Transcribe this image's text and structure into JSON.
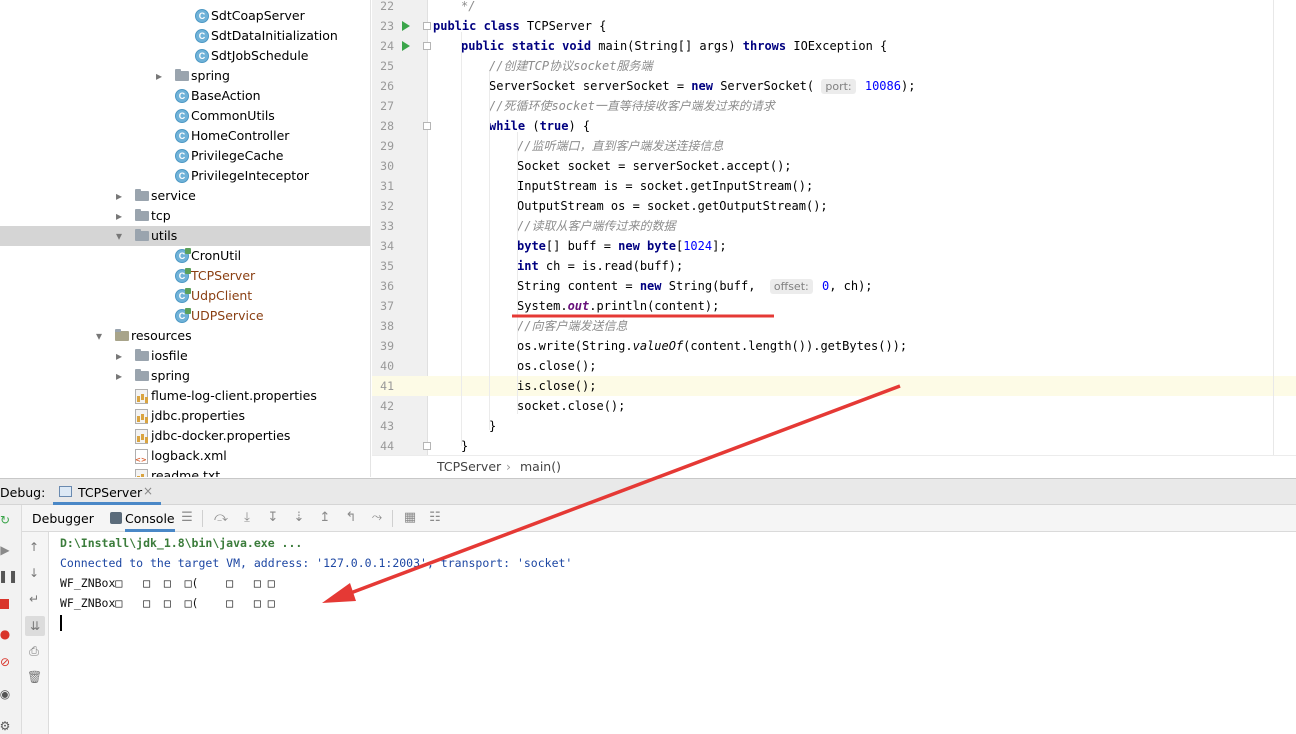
{
  "tree": {
    "items": [
      {
        "label": "SdtCoapServer",
        "icon": "class-icon",
        "depth": 4,
        "mod": false
      },
      {
        "label": "SdtDataInitialization",
        "icon": "class-icon",
        "depth": 4,
        "mod": false
      },
      {
        "label": "SdtJobSchedule",
        "icon": "class-icon",
        "depth": 4,
        "mod": false
      },
      {
        "label": "spring",
        "icon": "folder-icon",
        "depth": 3,
        "arrow": "›"
      },
      {
        "label": "BaseAction",
        "icon": "class-icon",
        "depth": 3,
        "mod": false
      },
      {
        "label": "CommonUtils",
        "icon": "class-icon",
        "depth": 3,
        "mod": false
      },
      {
        "label": "HomeController",
        "icon": "class-icon",
        "depth": 3,
        "mod": false
      },
      {
        "label": "PrivilegeCache",
        "icon": "class-icon",
        "depth": 3,
        "mod": false
      },
      {
        "label": "PrivilegeInteceptor",
        "icon": "class-icon",
        "depth": 3,
        "mod": false
      },
      {
        "label": "service",
        "icon": "folder-icon",
        "depth": 2,
        "arrow": "›"
      },
      {
        "label": "tcp",
        "icon": "folder-icon",
        "depth": 2,
        "arrow": "›"
      },
      {
        "label": "utils",
        "icon": "folder-icon",
        "depth": 2,
        "arrow": "⌄",
        "selected": true
      },
      {
        "label": "CronUtil",
        "icon": "class-icon",
        "depth": 3,
        "mod": true,
        "plain": true
      },
      {
        "label": "TCPServer",
        "icon": "class-icon",
        "depth": 3,
        "mod": true
      },
      {
        "label": "UdpClient",
        "icon": "class-icon",
        "depth": 3,
        "mod": true
      },
      {
        "label": "UDPService",
        "icon": "class-icon",
        "depth": 3,
        "mod": true
      },
      {
        "label": "resources",
        "icon": "resources-folder-icon",
        "depth": 1,
        "arrow": "⌄"
      },
      {
        "label": "iosfile",
        "icon": "folder-icon",
        "depth": 2,
        "arrow": "›"
      },
      {
        "label": "spring",
        "icon": "folder-icon",
        "depth": 2,
        "arrow": "›"
      },
      {
        "label": "flume-log-client.properties",
        "icon": "properties-file-icon",
        "depth": 2
      },
      {
        "label": "jdbc.properties",
        "icon": "properties-file-icon",
        "depth": 2
      },
      {
        "label": "jdbc-docker.properties",
        "icon": "properties-file-icon",
        "depth": 2
      },
      {
        "label": "logback.xml",
        "icon": "xml-file-icon",
        "depth": 2
      },
      {
        "label": "readme.txt",
        "icon": "text-file-icon",
        "depth": 2
      }
    ]
  },
  "editor": {
    "lines": [
      {
        "n": "22",
        "html": "<span class='cm'>*/</span>",
        "indent": 1
      },
      {
        "n": "23",
        "run": true,
        "fold": true,
        "html": "<span class='kw'>public class</span> TCPServer {",
        "indent": 0
      },
      {
        "n": "24",
        "run": true,
        "fold": true,
        "html": "<span class='kw'>public static void</span> main(String[] args) <span class='kw'>throws</span> IOException {",
        "indent": 1
      },
      {
        "n": "25",
        "html": "<span class='cm'>//创建TCP协议socket服务端</span>",
        "indent": 2
      },
      {
        "n": "26",
        "html": "ServerSocket serverSocket = <span class='kw'>new</span> ServerSocket( <span class='hint'>port:</span> <span class='num'>10086</span>);",
        "indent": 2
      },
      {
        "n": "27",
        "html": "<span class='cm'>//死循环使socket一直等待接收客户端发过来的请求</span>",
        "indent": 2
      },
      {
        "n": "28",
        "fold": true,
        "html": "<span class='kw'>while</span> (<span class='kw'>true</span>) {",
        "indent": 2
      },
      {
        "n": "29",
        "html": "<span class='cm'>//监听端口，直到客户端发送连接信息</span>",
        "indent": 3
      },
      {
        "n": "30",
        "html": "Socket socket = serverSocket.accept();",
        "indent": 3
      },
      {
        "n": "31",
        "html": "InputStream is = socket.getInputStream();",
        "indent": 3
      },
      {
        "n": "32",
        "html": "OutputStream os = socket.getOutputStream();",
        "indent": 3
      },
      {
        "n": "33",
        "html": "<span class='cm'>//读取从客户端传过来的数据</span>",
        "indent": 3
      },
      {
        "n": "34",
        "html": "<span class='kw'>byte</span>[] buff = <span class='kw'>new byte</span>[<span class='num'>1024</span>];",
        "indent": 3
      },
      {
        "n": "35",
        "html": "<span class='kw'>int</span> ch = is.read(buff);",
        "indent": 3
      },
      {
        "n": "36",
        "html": "String content = <span class='kw'>new</span> String(buff,  <span class='hint'>offset:</span> <span class='num'>0</span>, ch);",
        "indent": 3
      },
      {
        "n": "37",
        "html": "System.<span class='fld'>out</span>.println(content);",
        "indent": 3
      },
      {
        "n": "38",
        "html": "<span class='cm'>//向客户端发送信息</span>",
        "indent": 3
      },
      {
        "n": "39",
        "html": "os.write(String.<span class='it'>valueOf</span>(content.length()).getBytes());",
        "indent": 3
      },
      {
        "n": "40",
        "html": "os.close();",
        "indent": 3
      },
      {
        "n": "41",
        "html": "is.close();",
        "indent": 3,
        "current": true
      },
      {
        "n": "42",
        "html": "socket.close();",
        "indent": 3
      },
      {
        "n": "43",
        "html": "}",
        "indent": 2
      },
      {
        "n": "44",
        "fold": true,
        "html": "}",
        "indent": 1
      }
    ],
    "breadcrumb": {
      "class": "TCPServer",
      "sep": "›",
      "method": "main()"
    }
  },
  "debug": {
    "label": "Debug:",
    "tab_label": "TCPServer",
    "tab_close": "×",
    "tabs": [
      "Debugger",
      "Console"
    ],
    "active_tab": "Console"
  },
  "console": {
    "lines": [
      {
        "kind": "cmd",
        "text": "D:\\Install\\jdk_1.8\\bin\\java.exe ..."
      },
      {
        "kind": "info",
        "text": "Connected to the target VM, address: '127.0.0.1:2003', transport: 'socket'"
      },
      {
        "kind": "out",
        "text": "WF_ZNBox□   □  □  □(    □   □ □"
      },
      {
        "kind": "out",
        "text": "WF_ZNBox□   □  □  □(    □   □ □"
      }
    ]
  },
  "colors": {
    "annotation": "#e53935",
    "accent": "#4a88c7",
    "current_line": "#fdfbe6"
  }
}
